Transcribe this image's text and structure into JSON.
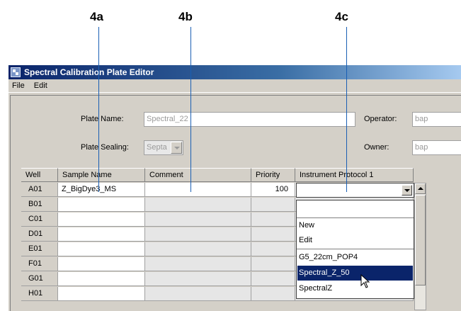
{
  "callouts": [
    "4a",
    "4b",
    "4c"
  ],
  "window": {
    "title": "Spectral Calibration Plate Editor"
  },
  "menu": [
    "File",
    "Edit"
  ],
  "form": {
    "plate_name_label": "Plate Name:",
    "plate_name_value": "Spectral_22",
    "operator_label": "Operator:",
    "operator_value": "bap",
    "plate_sealing_label": "Plate Sealing:",
    "plate_sealing_value": "Septa",
    "owner_label": "Owner:",
    "owner_value": "bap"
  },
  "table": {
    "columns": [
      "Well",
      "Sample Name",
      "Comment",
      "Priority",
      "Instrument Protocol 1"
    ],
    "rows": [
      {
        "well": "A01",
        "sample": "Z_BigDye3_MS",
        "comment": "",
        "priority": "100",
        "protocol": ""
      },
      {
        "well": "B01",
        "sample": "",
        "comment": "",
        "priority": "",
        "protocol": ""
      },
      {
        "well": "C01",
        "sample": "",
        "comment": "",
        "priority": "",
        "protocol": ""
      },
      {
        "well": "D01",
        "sample": "",
        "comment": "",
        "priority": "",
        "protocol": ""
      },
      {
        "well": "E01",
        "sample": "",
        "comment": "",
        "priority": "",
        "protocol": ""
      },
      {
        "well": "F01",
        "sample": "",
        "comment": "",
        "priority": "",
        "protocol": ""
      },
      {
        "well": "G01",
        "sample": "",
        "comment": "",
        "priority": "",
        "protocol": ""
      },
      {
        "well": "H01",
        "sample": "",
        "comment": "",
        "priority": "",
        "protocol": ""
      }
    ]
  },
  "protocol_dropdown": {
    "options": [
      "",
      "New",
      "Edit",
      "G5_22cm_POP4",
      "Spectral_Z_50",
      "SpectralZ"
    ],
    "highlighted": "Spectral_Z_50"
  },
  "colors": {
    "title_bar": "#0a246a",
    "callout_line": "#1a5fb4",
    "selection": "#0a246a",
    "window_bg": "#d4d0c8"
  }
}
